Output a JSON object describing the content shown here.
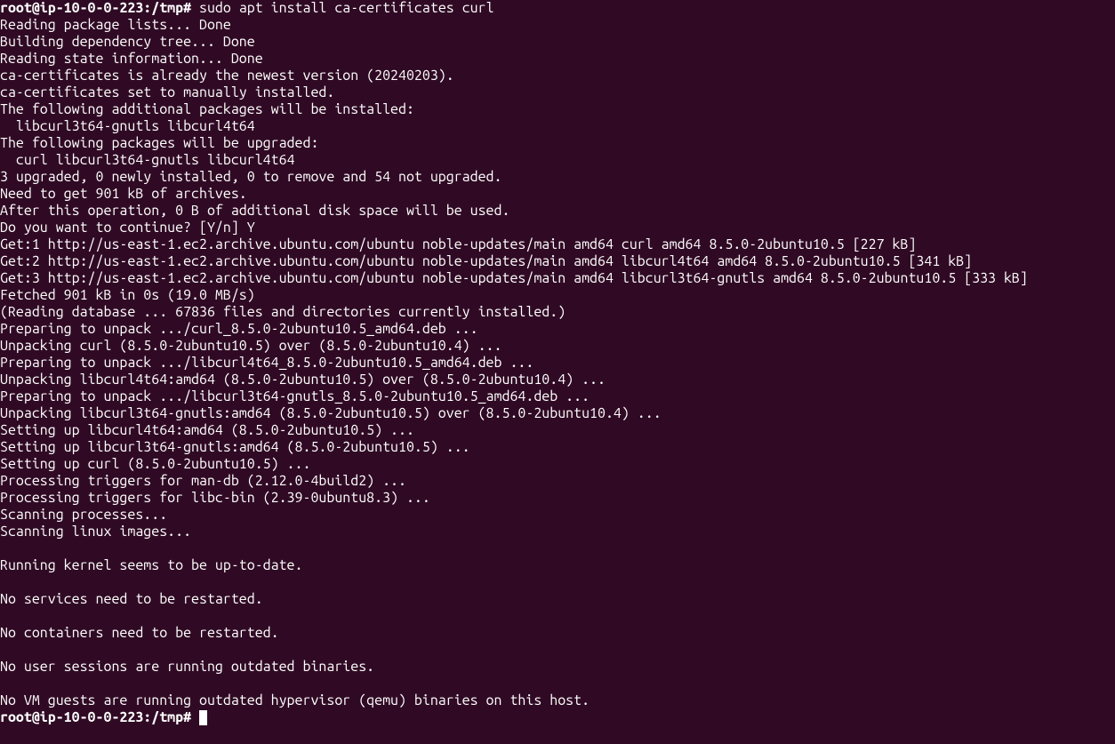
{
  "prompt1": "root@ip-10-0-0-223:/tmp# ",
  "command1": "sudo apt install ca-certificates curl",
  "lines": [
    "Reading package lists... Done",
    "Building dependency tree... Done",
    "Reading state information... Done",
    "ca-certificates is already the newest version (20240203).",
    "ca-certificates set to manually installed.",
    "The following additional packages will be installed:",
    "  libcurl3t64-gnutls libcurl4t64",
    "The following packages will be upgraded:",
    "  curl libcurl3t64-gnutls libcurl4t64",
    "3 upgraded, 0 newly installed, 0 to remove and 54 not upgraded.",
    "Need to get 901 kB of archives.",
    "After this operation, 0 B of additional disk space will be used.",
    "Do you want to continue? [Y/n] Y",
    "Get:1 http://us-east-1.ec2.archive.ubuntu.com/ubuntu noble-updates/main amd64 curl amd64 8.5.0-2ubuntu10.5 [227 kB]",
    "Get:2 http://us-east-1.ec2.archive.ubuntu.com/ubuntu noble-updates/main amd64 libcurl4t64 amd64 8.5.0-2ubuntu10.5 [341 kB]",
    "Get:3 http://us-east-1.ec2.archive.ubuntu.com/ubuntu noble-updates/main amd64 libcurl3t64-gnutls amd64 8.5.0-2ubuntu10.5 [333 kB]",
    "Fetched 901 kB in 0s (19.0 MB/s)",
    "(Reading database ... 67836 files and directories currently installed.)",
    "Preparing to unpack .../curl_8.5.0-2ubuntu10.5_amd64.deb ...",
    "Unpacking curl (8.5.0-2ubuntu10.5) over (8.5.0-2ubuntu10.4) ...",
    "Preparing to unpack .../libcurl4t64_8.5.0-2ubuntu10.5_amd64.deb ...",
    "Unpacking libcurl4t64:amd64 (8.5.0-2ubuntu10.5) over (8.5.0-2ubuntu10.4) ...",
    "Preparing to unpack .../libcurl3t64-gnutls_8.5.0-2ubuntu10.5_amd64.deb ...",
    "Unpacking libcurl3t64-gnutls:amd64 (8.5.0-2ubuntu10.5) over (8.5.0-2ubuntu10.4) ...",
    "Setting up libcurl4t64:amd64 (8.5.0-2ubuntu10.5) ...",
    "Setting up libcurl3t64-gnutls:amd64 (8.5.0-2ubuntu10.5) ...",
    "Setting up curl (8.5.0-2ubuntu10.5) ...",
    "Processing triggers for man-db (2.12.0-4build2) ...",
    "Processing triggers for libc-bin (2.39-0ubuntu8.3) ...",
    "Scanning processes...",
    "Scanning linux images...",
    "",
    "Running kernel seems to be up-to-date.",
    "",
    "No services need to be restarted.",
    "",
    "No containers need to be restarted.",
    "",
    "No user sessions are running outdated binaries.",
    "",
    "No VM guests are running outdated hypervisor (qemu) binaries on this host."
  ],
  "prompt2": "root@ip-10-0-0-223:/tmp# "
}
